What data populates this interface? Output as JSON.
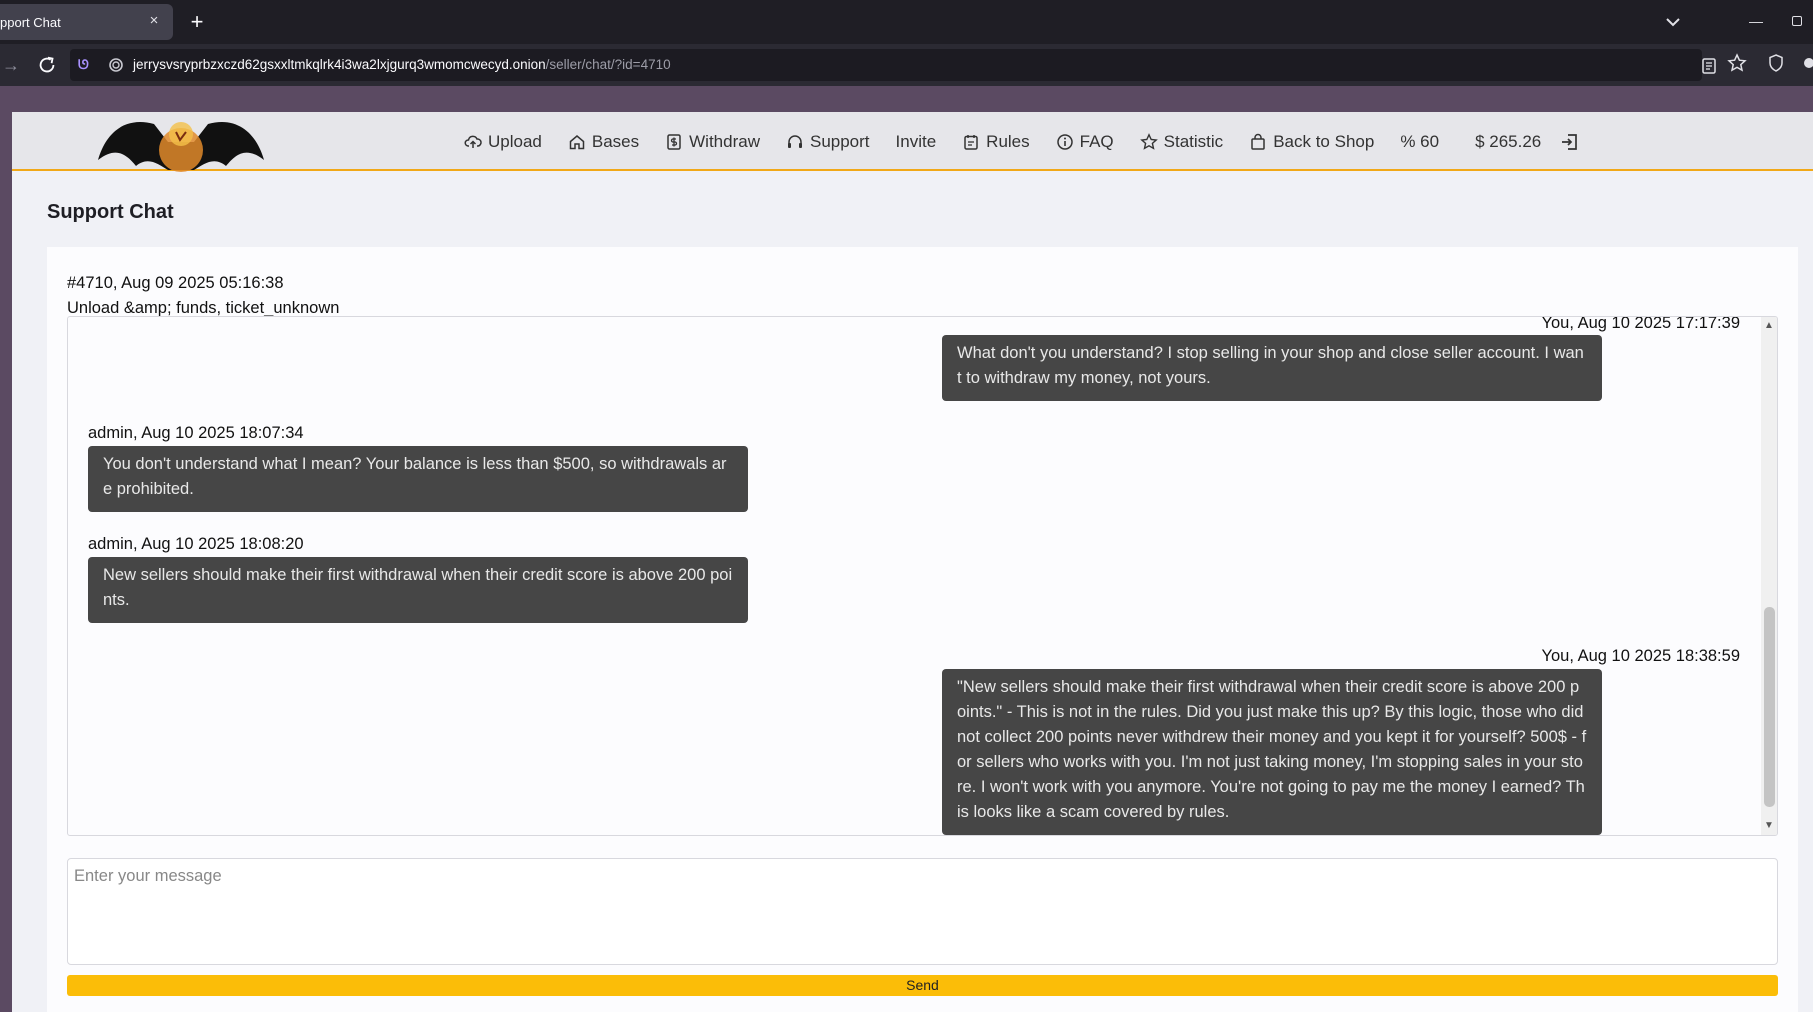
{
  "browser": {
    "tab_title": "pport Chat",
    "tab_close": "×",
    "new_tab": "+",
    "url_host": "jerrysvsryprbzxczd62gsxxltmkqlrk4i3wa2lxjgurq3wmomcwecyd.onion",
    "url_path": "/seller/chat/?id=4710",
    "minimize": "—"
  },
  "menu": {
    "upload": "Upload",
    "bases": "Bases",
    "withdraw": "Withdraw",
    "support": "Support",
    "invite": "Invite",
    "rules": "Rules",
    "faq": "FAQ",
    "statistic": "Statistic",
    "back_to_shop": "Back to Shop",
    "percent": "% 60",
    "balance": "$ 265.26"
  },
  "page": {
    "title": "Support Chat",
    "ticket_line1": "#4710, Aug 09 2025 05:16:38",
    "ticket_line2": "Unload &amp; funds, ticket_unknown"
  },
  "messages": [
    {
      "sender": "You, Aug 10 2025 17:17:39",
      "text": "What don't you understand? I stop selling in your shop and close seller account. I want to withdraw my money, not yours."
    },
    {
      "sender": "admin, Aug 10 2025 18:07:34",
      "text": "You don't understand what I mean? Your balance is less than $500, so withdrawals are prohibited."
    },
    {
      "sender": "admin, Aug 10 2025 18:08:20",
      "text": "New sellers should make their first withdrawal when their credit score is above 200 points."
    },
    {
      "sender": "You, Aug 10 2025 18:38:59",
      "text": "\"New sellers should make their first withdrawal when their credit score is above 200 points.\" - This is not in the rules. Did you just make this up? By this logic, those who did not collect 200 points never withdrew their money and you kept it for yourself? 500$ - for sellers who works with you. I'm not just taking money, I'm stopping sales in your store. I won't work with you anymore. You're not going to pay me the money I earned? This looks like a scam covered by rules."
    }
  ],
  "form": {
    "placeholder": "Enter your message",
    "send_label": "Send"
  },
  "colors": {
    "accent": "#fbbd08",
    "bubble": "#464646",
    "header_border": "#f1a818"
  },
  "icons": [
    "upload-cloud-icon",
    "home-icon",
    "dollar-doc-icon",
    "headset-icon",
    "clipboard-icon",
    "info-icon",
    "star-icon",
    "bag-icon",
    "logout-icon"
  ]
}
